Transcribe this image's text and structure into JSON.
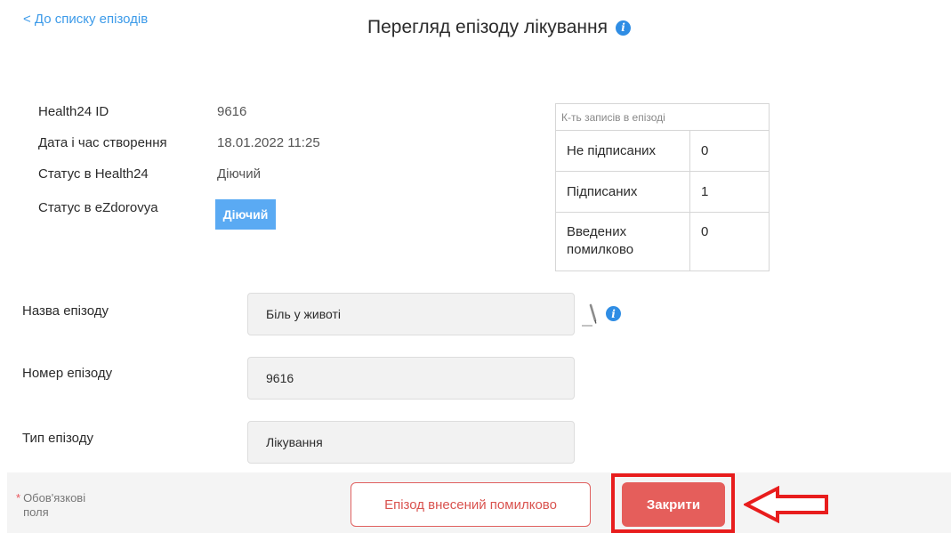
{
  "header": {
    "back_link": "< До списку епізодів",
    "title": "Перегляд епізоду лікування"
  },
  "details": {
    "id_label": "Health24 ID",
    "id_value": "9616",
    "created_label": "Дата і час створення",
    "created_value": "18.01.2022 11:25",
    "status_h24_label": "Статус в Health24",
    "status_h24_value": "Діючий",
    "status_ez_label": "Статус в eZdorovya",
    "status_ez_value": "Діючий"
  },
  "records": {
    "caption": "К-ть записів в епізоді",
    "rows": [
      {
        "label": "Не підписаних",
        "value": "0"
      },
      {
        "label": "Підписаних",
        "value": "1"
      },
      {
        "label": "Введених помилково",
        "value": "0"
      }
    ]
  },
  "form": {
    "name_label": "Назва епізоду",
    "name_value": "Біль у животі",
    "number_label": "Номер епізоду",
    "number_value": "9616",
    "type_label": "Тип епізоду",
    "type_value": "Лікування"
  },
  "footer": {
    "required_star": "*",
    "required_note_line1": "Обов'язкові",
    "required_note_line2": "поля",
    "error_button": "Епізод внесений помилково",
    "close_button": "Закрити"
  },
  "icons": {
    "info": "info-icon",
    "edit": "pencil-icon",
    "arrow": "left-arrow-annotation"
  },
  "colors": {
    "accent_blue": "#3d9be9",
    "badge_blue": "#5aaaf3",
    "danger_red": "#e55e5b",
    "annotation_red": "#e81d1d"
  }
}
